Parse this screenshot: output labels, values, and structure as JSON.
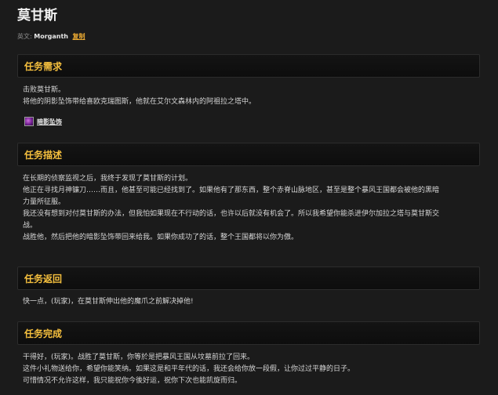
{
  "title": "莫甘斯",
  "subtitle": {
    "prefix": "英文:",
    "english_name": "Morganth",
    "copy_label": "复制"
  },
  "requirements": {
    "header": "任务需求",
    "lines": [
      "击败莫甘斯。",
      "将他的阴影坠饰带给喜欧克瑞图斯，他就在艾尔文森林内的阿祖拉之塔中。"
    ],
    "item": {
      "label": "暗影坠饰",
      "icon": "purple-pendant-icon"
    }
  },
  "description": {
    "header": "任务描述",
    "lines": [
      "在长期的侦察监视之后，我终于发现了莫甘斯的计划。",
      "他正在寻找月神镰刀……而且，他甚至可能已经找到了。如果他有了那东西，整个赤脊山脉地区，甚至是整个暴风王国都会被他的黑暗",
      "力量所征服。",
      "我还没有想到对付莫甘斯的办法，但我怕如果现在不行动的话，也许以后就没有机会了。所以我希望你能杀进伊尔加拉之塔与莫甘斯交",
      "战。",
      "战胜他，然后把他的暗影坠饰带回来给我。如果你成功了的话，整个王国都将以你为傲。"
    ]
  },
  "return": {
    "header": "任务返回",
    "lines": [
      "快一点，(玩家)，在莫甘斯伸出他的魔爪之前解决掉他!"
    ]
  },
  "completion": {
    "header": "任务完成",
    "lines": [
      "干得好，(玩家)。战胜了莫甘斯，你等於是把暴风王国从坟墓前拉了回来。",
      "这件小礼物送给你，希望你能笑纳。如果这是和平年代的话，我还会给你放一段假，让你过过平静的日子。",
      "可惜情况不允许这样，我只能祝你今後好运，祝你下次也能凯旋而归。"
    ]
  },
  "colors": {
    "background": "#1b1b1b",
    "header_text": "#f6c03e",
    "link": "#e8a832"
  }
}
